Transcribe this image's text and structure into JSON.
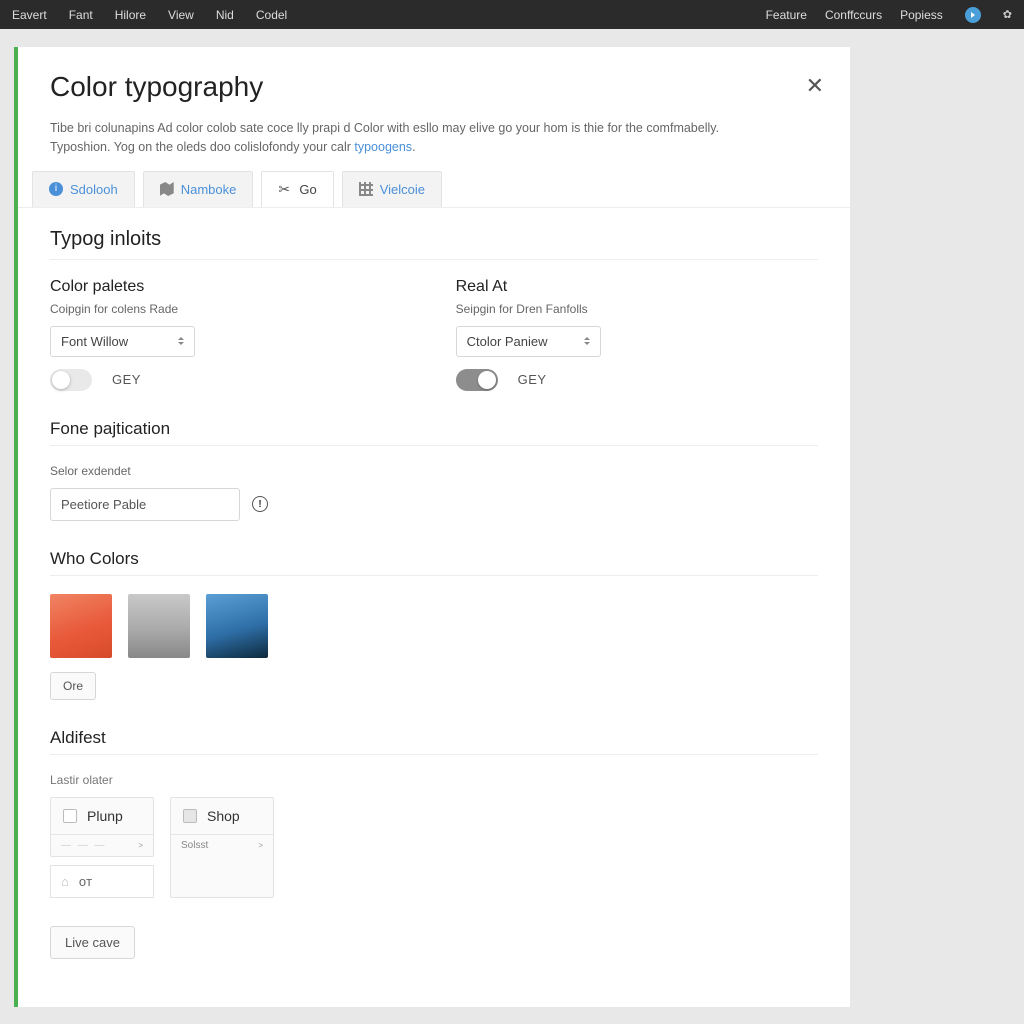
{
  "topbar": {
    "left": [
      "Eavert",
      "Fant",
      "Hilore",
      "View",
      "Nid",
      "Codel"
    ],
    "right": [
      "Feature",
      "Conffccurs",
      "Popiess"
    ]
  },
  "panel": {
    "title": "Color typography",
    "desc_prefix": "Tibe bri colunapins Ad color colob sate coce lly prapi d Color with esllo may elive go your hom is thie for the comfmabelly. Typoshion. Yog on the oleds doo colislofondy your calr ",
    "desc_link": "typoogens",
    "desc_suffix": ".",
    "tabs": [
      {
        "label": "Sdolooh",
        "icon": "info"
      },
      {
        "label": "Namboke",
        "icon": "map"
      },
      {
        "label": "Go",
        "icon": "cut",
        "active": true
      },
      {
        "label": "Vielcoie",
        "icon": "grid"
      }
    ]
  },
  "section1": {
    "heading": "Typog inloits",
    "left": {
      "title": "Color paletes",
      "desc": "Coipgin for colens Rade",
      "select": "Font Willow",
      "toggle": "GEY",
      "toggle_on": false
    },
    "right": {
      "title": "Real At",
      "desc": "Seipgin for Dren Fanfolls",
      "select": "Ctolor Paniew",
      "toggle": "GEY",
      "toggle_on": true
    }
  },
  "section2": {
    "heading": "Fone pajtication",
    "desc": "Selor exdendet",
    "input": "Peetiore Pable"
  },
  "section3": {
    "heading": "Who Colors",
    "swatches": [
      "orange-swatch",
      "gray-swatch",
      "blue-swatch"
    ],
    "btn": "Ore"
  },
  "section4": {
    "heading": "Aldifest",
    "desc": "Lastir olater",
    "cards": [
      {
        "label": "Plunp",
        "foot": "—  —  —",
        "foot_r": ">"
      },
      {
        "label": "Shop",
        "foot": "Solsst",
        "foot_r": ">"
      }
    ],
    "or_label": "oт"
  },
  "footer": {
    "live": "Live cave"
  }
}
